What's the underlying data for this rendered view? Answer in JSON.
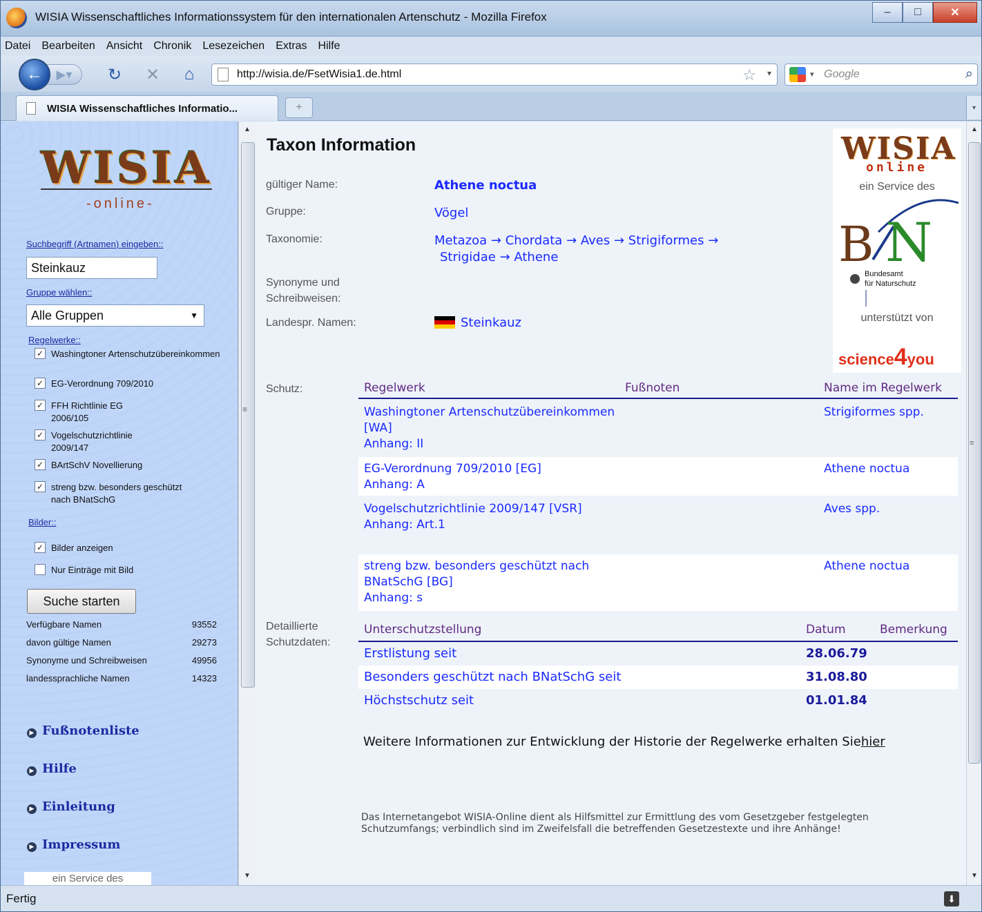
{
  "window": {
    "title": "WISIA Wissenschaftliches Informationssystem für den internationalen Artenschutz - Mozilla Firefox"
  },
  "menu": [
    "Datei",
    "Bearbeiten",
    "Ansicht",
    "Chronik",
    "Lesezeichen",
    "Extras",
    "Hilfe"
  ],
  "nav": {
    "url": "http://wisia.de/FsetWisia1.de.html",
    "search_placeholder": "Google"
  },
  "tab": {
    "label": "WISIA Wissenschaftliches Informatio..."
  },
  "sidebar": {
    "logo_text": "WISIA",
    "online_text": "-online-",
    "search_label": "Suchbegriff (Artnamen) eingeben::",
    "search_value": "Steinkauz",
    "group_label": "Gruppe wählen::",
    "group_value": "Alle Gruppen",
    "regelwerke_label": "Regelwerke::",
    "regelwerke": [
      {
        "label": "Washingtoner Artenschutzübereinkommen",
        "checked": true
      },
      {
        "label": "EG-Verordnung 709/2010",
        "checked": true
      },
      {
        "label": "FFH Richtlinie EG 2006/105",
        "checked": true
      },
      {
        "label": "Vogelschutzrichtlinie 2009/147",
        "checked": true
      },
      {
        "label": "BArtSchV Novellierung",
        "checked": true
      },
      {
        "label": "streng bzw. besonders geschützt nach BNatSchG",
        "checked": true
      }
    ],
    "bilder_label": "Bilder::",
    "bilder": [
      {
        "label": "Bilder anzeigen",
        "checked": true
      },
      {
        "label": "Nur Einträge mit Bild",
        "checked": false
      }
    ],
    "search_button": "Suche starten",
    "stats": [
      {
        "label": "Verfügbare Namen",
        "value": "93552"
      },
      {
        "label": "davon gültige Namen",
        "value": "29273"
      },
      {
        "label": "Synonyme und Schreibweisen",
        "value": "49956"
      },
      {
        "label": "landessprachliche Namen",
        "value": "14323"
      }
    ],
    "links": [
      "Fußnotenliste",
      "Hilfe",
      "Einleitung",
      "Impressum"
    ],
    "service_box": "ein Service des"
  },
  "main": {
    "title": "Taxon Information",
    "fields": {
      "valid_name_label": "gültiger Name:",
      "valid_name": "Athene noctua",
      "group_label": "Gruppe:",
      "group": "Vögel",
      "taxonomy_label": "Taxonomie:",
      "taxonomy": [
        "Metazoa",
        "Chordata",
        "Aves",
        "Strigiformes",
        "Strigidae",
        "Athene"
      ],
      "synonyms_label": "Synonyme und Schreibweisen:",
      "common_names_label": "Landespr. Namen:",
      "common_name": "Steinkauz"
    },
    "logo_box": {
      "wisia": "WISIA",
      "online": "online",
      "service": "ein Service des",
      "bfn_letters": "BfN",
      "bfn_name_1": "Bundesamt",
      "bfn_name_2": "für Naturschutz",
      "supported": "unterstützt von",
      "sponsor_1": "science",
      "sponsor_2": "4",
      "sponsor_3": "you"
    },
    "schutz_label": "Schutz:",
    "schutz_headers": {
      "regelwerk": "Regelwerk",
      "fussnoten": "Fußnoten",
      "name": "Name im Regelwerk"
    },
    "schutz_rows": [
      {
        "regelwerk": "Washingtoner Artenschutzübereinkommen [WA]",
        "anhang": "Anhang: II",
        "name": "Strigiformes spp."
      },
      {
        "regelwerk": "EG-Verordnung 709/2010 [EG]",
        "anhang": "Anhang: A",
        "name": "Athene noctua"
      },
      {
        "regelwerk": "Vogelschutzrichtlinie 2009/147 [VSR]",
        "anhang": "Anhang: Art.1",
        "name": "Aves spp."
      },
      {
        "regelwerk": "streng bzw. besonders geschützt nach BNatSchG [BG]",
        "anhang": "Anhang: s",
        "name": "Athene noctua"
      }
    ],
    "detail_label": "Detaillierte Schutzdaten:",
    "detail_headers": {
      "status": "Unterschutzstellung",
      "date": "Datum",
      "remark": "Bemerkung"
    },
    "detail_rows": [
      {
        "status": "Erstlistung seit",
        "date": "28.06.79"
      },
      {
        "status": "Besonders geschützt nach BNatSchG seit",
        "date": "31.08.80"
      },
      {
        "status": "Höchstschutz seit",
        "date": "01.01.84"
      }
    ],
    "more_info": "Weitere Informationen zur Entwicklung der Historie der Regelwerke erhalten Sie",
    "more_info_link": "hier",
    "disclaimer": "Das Internetangebot WISIA-Online dient als Hilfsmittel zur Ermittlung des vom Gesetzgeber festgelegten Schutzumfangs; verbindlich sind im Zweifelsfall die betreffenden Gesetzestexte und ihre Anhänge!"
  },
  "status": {
    "text": "Fertig"
  }
}
